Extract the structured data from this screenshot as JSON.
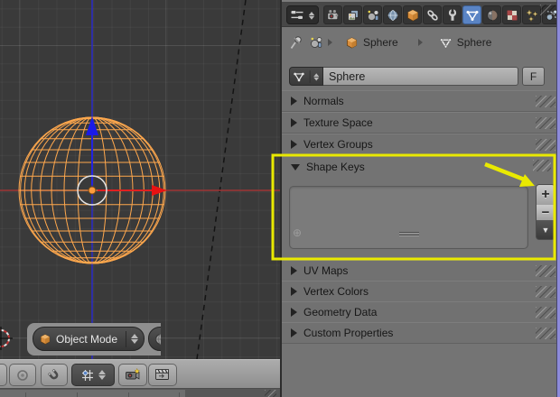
{
  "viewport": {
    "mode_selector": "Object Mode",
    "header_tools": [
      "proportional-editing",
      "snap-toggle",
      "snap-element",
      "render-still",
      "render-animation"
    ],
    "scene_object": "UV Sphere wireframe (selected)"
  },
  "properties_editor": {
    "tabs": [
      {
        "id": "render",
        "icon": "camera-icon"
      },
      {
        "id": "render-layers",
        "icon": "layers-icon"
      },
      {
        "id": "scene",
        "icon": "scene-icon"
      },
      {
        "id": "world",
        "icon": "world-icon"
      },
      {
        "id": "object",
        "icon": "cube-icon"
      },
      {
        "id": "constraints",
        "icon": "chain-icon"
      },
      {
        "id": "modifiers",
        "icon": "wrench-icon"
      },
      {
        "id": "object-data",
        "icon": "mesh-data-icon",
        "active": true
      },
      {
        "id": "material",
        "icon": "material-icon"
      },
      {
        "id": "texture",
        "icon": "checker-icon"
      },
      {
        "id": "particles",
        "icon": "sparkles-icon"
      },
      {
        "id": "physics",
        "icon": "physics-icon"
      }
    ],
    "breadcrumb": {
      "object_label": "Sphere",
      "data_label": "Sphere"
    },
    "datablock": {
      "name": "Sphere",
      "fake_user_button": "F"
    },
    "panels": [
      {
        "label": "Normals",
        "state": "collapsed"
      },
      {
        "label": "Texture Space",
        "state": "collapsed"
      },
      {
        "label": "Vertex Groups",
        "state": "collapsed"
      },
      {
        "label": "Shape Keys",
        "state": "expanded"
      },
      {
        "label": "UV Maps",
        "state": "collapsed"
      },
      {
        "label": "Vertex Colors",
        "state": "collapsed"
      },
      {
        "label": "Geometry Data",
        "state": "collapsed"
      },
      {
        "label": "Custom Properties",
        "state": "collapsed"
      }
    ],
    "shape_keys": {
      "list_items": [],
      "add_button": "+",
      "remove_button": "−",
      "specials_button": "▼"
    }
  },
  "annotation": {
    "shape": "rectangle-and-arrow",
    "target": "shape-keys-add-button",
    "color": "#e9e900"
  },
  "colors": {
    "active_tab_blue": "#5a84c4",
    "selected_wire_orange": "#ffa84d",
    "axis_red": "#9e3434",
    "axis_blue": "#2a2ac8",
    "annotation_yellow": "#e9e900",
    "panel_gray": "#747474",
    "viewport_gray": "#3a3a3a"
  }
}
